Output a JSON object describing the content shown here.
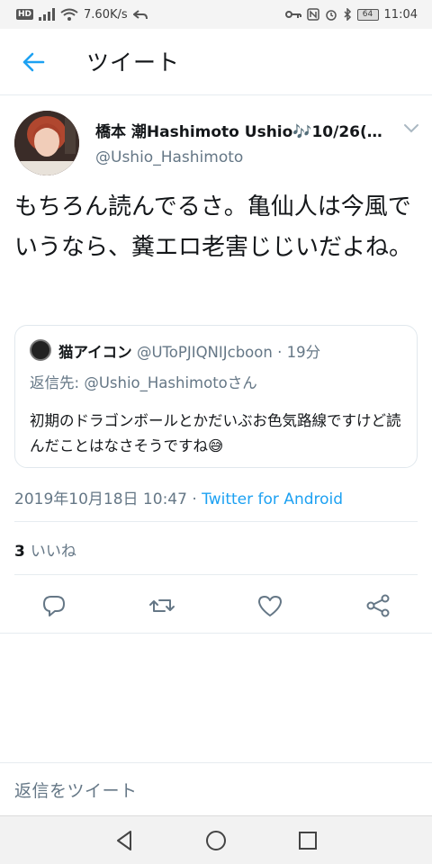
{
  "status_bar": {
    "hd_badge": "HD",
    "net_speed": "7.60K/s",
    "battery_level": "64",
    "time": "11:04"
  },
  "app_bar": {
    "title": "ツイート",
    "back_icon": "arrow-left-icon"
  },
  "tweet": {
    "author_name": "橋本 潮Hashimoto Ushio🎶10/26(…",
    "author_handle": "@Ushio_Hashimoto",
    "text": "もちろん読んでるさ。亀仙人は今風でいうなら、糞エロ老害じじいだよね。",
    "timestamp": "2019年10月18日 10:47",
    "separator": "·",
    "source": "Twitter for Android",
    "like_count": "3",
    "like_label": "いいね"
  },
  "quoted_tweet": {
    "name": "猫アイコン",
    "handle": "@UToPJIQNIJcboon",
    "separator": "·",
    "age": "19分",
    "reply_prefix": "返信先: ",
    "reply_to": "@Ushio_Hashimoto",
    "reply_suffix": "さん",
    "text": "初期のドラゴンボールとかだいぶお色気路線ですけど読んだことはなさそうですね😅"
  },
  "actions": [
    "reply-icon",
    "retweet-icon",
    "like-icon",
    "share-icon"
  ],
  "reply_bar": {
    "placeholder": "返信をツイート"
  },
  "colors": {
    "accent": "#1da1f2",
    "secondary_text": "#657786",
    "primary_text": "#14171a",
    "divider": "#e6ecf0"
  }
}
